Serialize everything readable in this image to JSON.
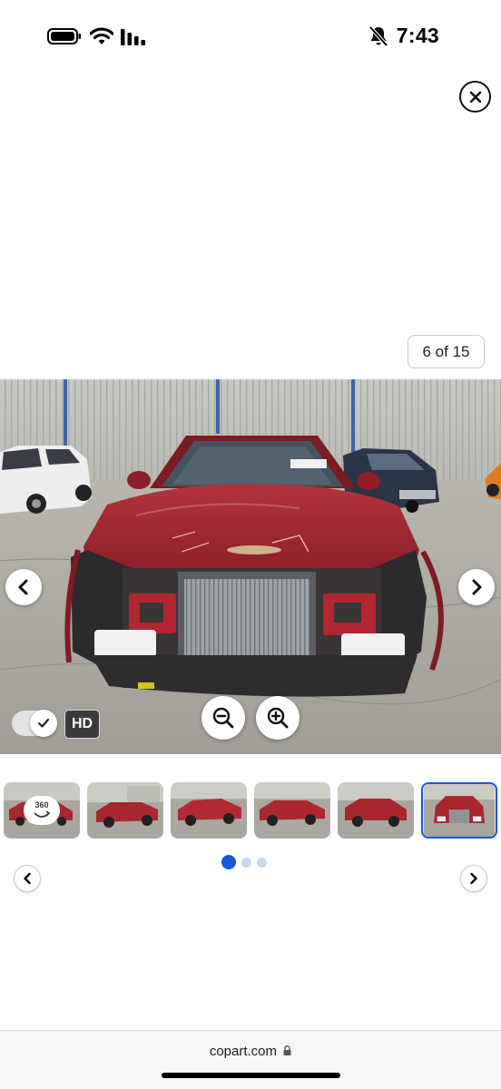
{
  "status_bar": {
    "time": "7:43",
    "icons": [
      "battery-icon",
      "wifi-icon",
      "cellular-signal-icon",
      "bell-slash-icon"
    ]
  },
  "viewer": {
    "counter": "6 of 15",
    "hd_label": "HD",
    "badge_360": "360",
    "thumbnail_count": 6,
    "active_thumbnail": 6,
    "pagination": {
      "pages": 3,
      "active": 1
    },
    "icons": {
      "close": "close-icon",
      "prev": "chevron-left-icon",
      "next": "chevron-right-icon",
      "zoom_out": "zoom-out-icon",
      "zoom_in": "zoom-in-icon",
      "toggle": "checkmark-icon",
      "rotate": "rotate-360-icon"
    }
  },
  "browser": {
    "url": "copart.com",
    "url_icon": "lock-icon"
  },
  "colors": {
    "accent": "#1a56db",
    "dot_inactive": "#c9d6ef",
    "car_red": "#a8262e",
    "hd_badge": "#3b3b3b"
  }
}
